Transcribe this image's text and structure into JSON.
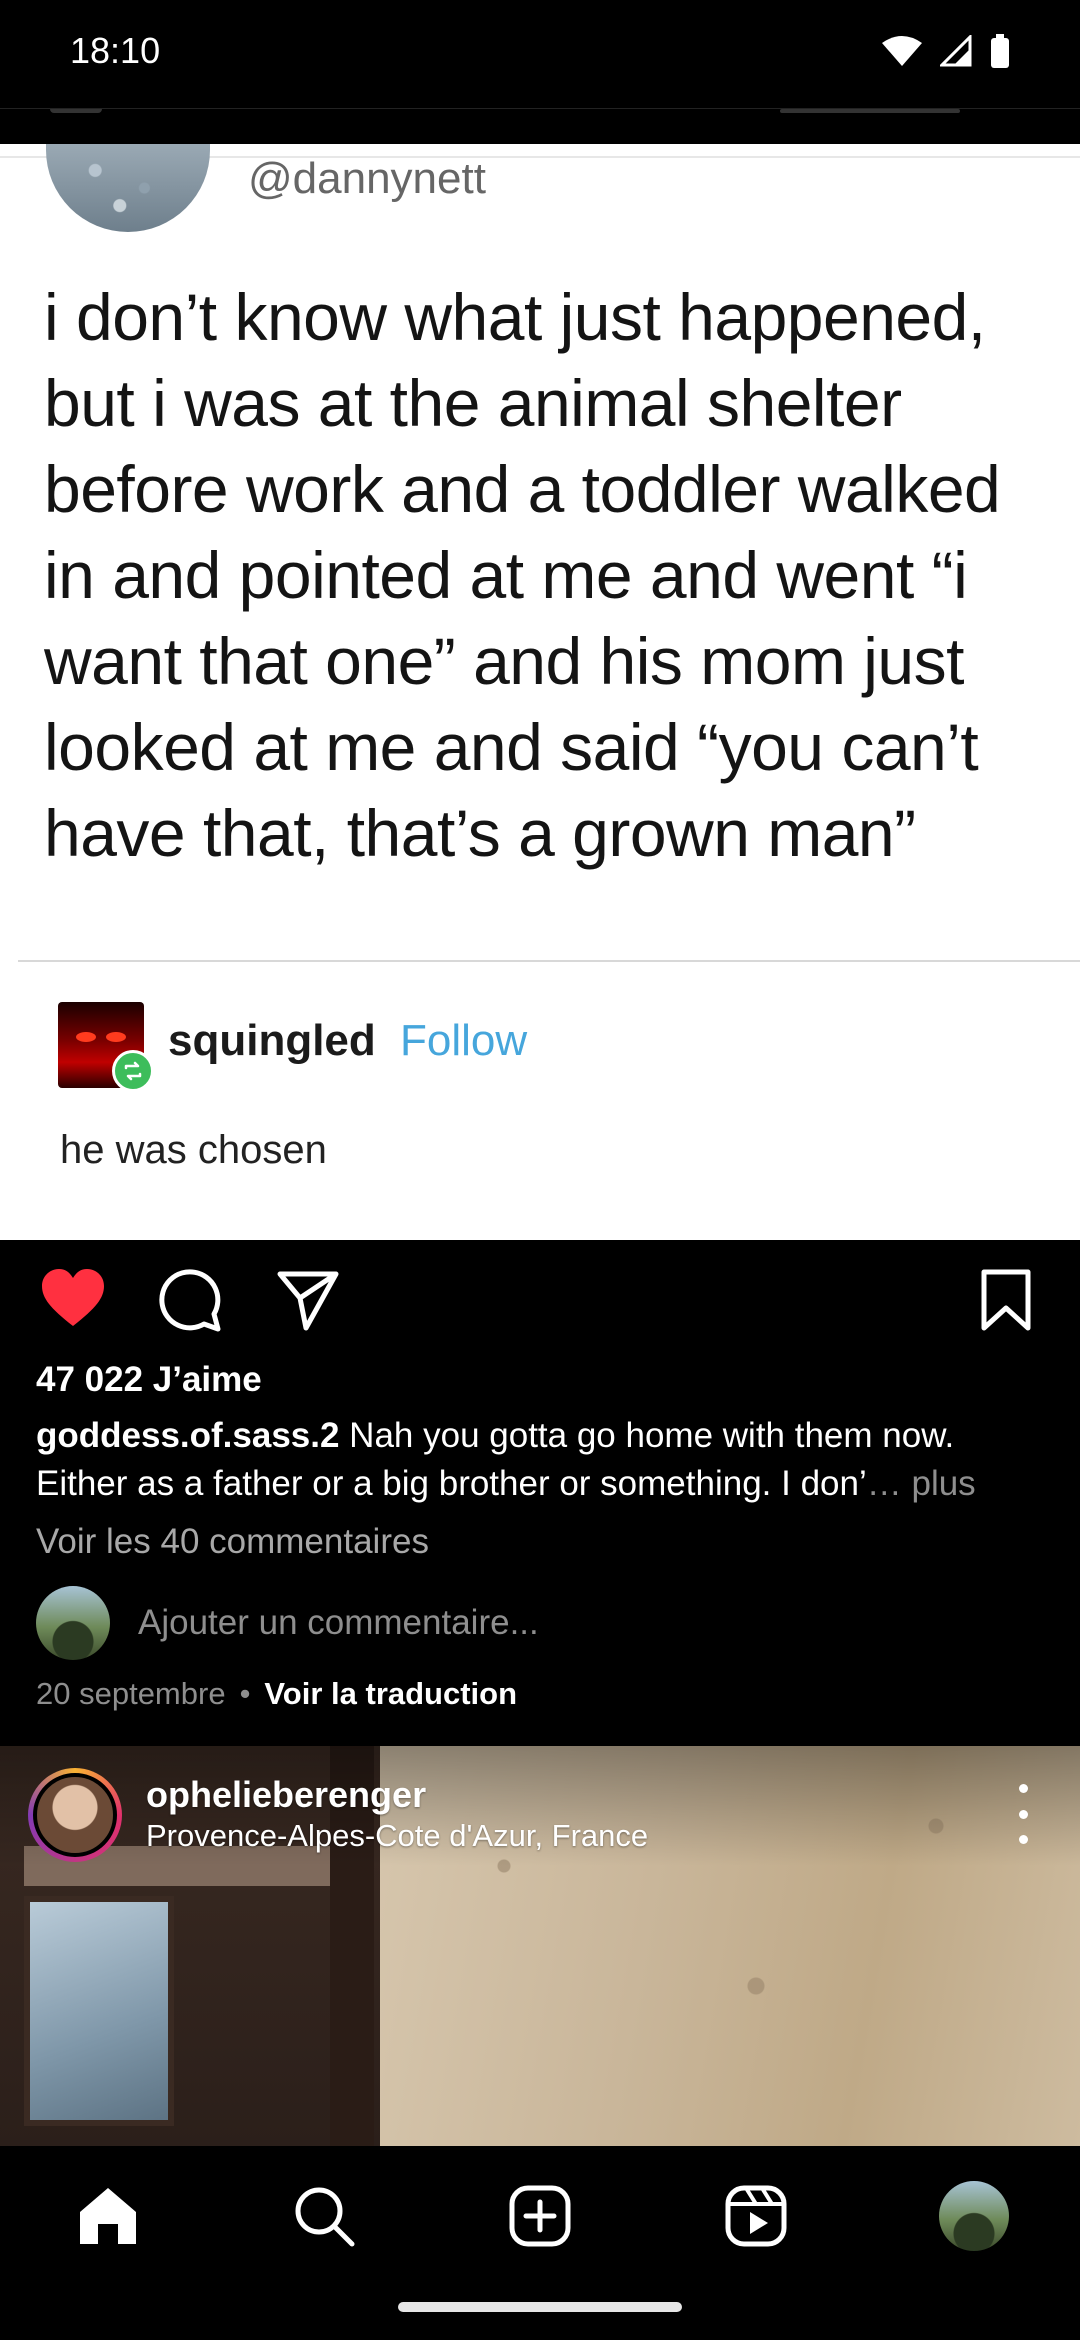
{
  "status_bar": {
    "time": "18:10",
    "icons": [
      "wifi-icon",
      "cellular-signal-icon",
      "battery-icon"
    ]
  },
  "post": {
    "image": {
      "tweet_handle": "@dannynett",
      "tweet_lines": [
        "i don’t know what just happened,",
        "but i was at the animal shelter",
        "before work and a toddler walked",
        "in and pointed at me and went “i",
        "want that one” and his mom just",
        "looked at me and said “you can’t",
        "have that, that’s a grown man”"
      ],
      "reblogger": "squingled",
      "follow_label": "Follow",
      "reblog_text": "he was chosen"
    },
    "actions": {
      "like_icon": "heart-filled-icon",
      "comment_icon": "comment-icon",
      "share_icon": "send-icon",
      "save_icon": "bookmark-icon",
      "like_color": "#ff3040"
    },
    "likes": "47 022 J’aime",
    "caption": {
      "username": "goddess.of.sass.2",
      "text": " Nah you gotta go home with them now. Either as a father or a big brother or something. I don’",
      "ellipsis": "…",
      "more": " plus"
    },
    "view_comments": "Voir les 40 commentaires",
    "add_comment_placeholder": "Ajouter un commentaire...",
    "date": "20 septembre",
    "separator": "•",
    "translate": "Voir la traduction"
  },
  "next_post": {
    "username": "ophelieberenger",
    "location": "Provence-Alpes-Cote d'Azur, France"
  },
  "bottom_nav": {
    "items": [
      "home-icon",
      "search-icon",
      "create-icon",
      "reels-icon",
      "profile-avatar"
    ]
  }
}
